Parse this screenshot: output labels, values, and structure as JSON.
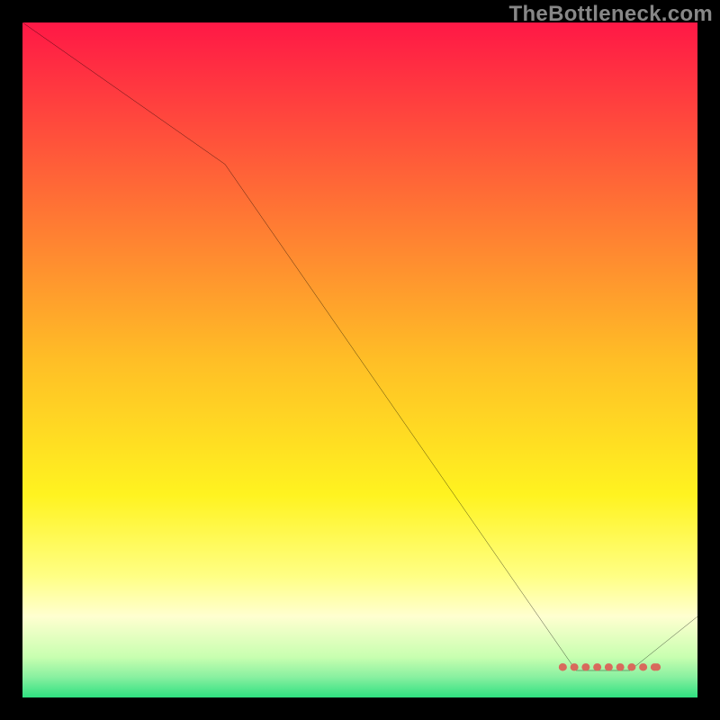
{
  "watermark": "TheBottleneck.com",
  "chart_data": {
    "type": "line",
    "title": "",
    "xlabel": "",
    "ylabel": "",
    "xlim": [
      0,
      100
    ],
    "ylim": [
      0,
      100
    ],
    "grid": false,
    "line": {
      "x": [
        0,
        30,
        82,
        90,
        100
      ],
      "values": [
        100,
        79,
        4,
        4,
        12
      ]
    },
    "gradient_stops": [
      {
        "offset": 0.0,
        "color": "#ff1846"
      },
      {
        "offset": 0.5,
        "color": "#ffbe26"
      },
      {
        "offset": 0.7,
        "color": "#fff320"
      },
      {
        "offset": 0.82,
        "color": "#ffff84"
      },
      {
        "offset": 0.88,
        "color": "#ffffd0"
      },
      {
        "offset": 0.94,
        "color": "#c8ffb0"
      },
      {
        "offset": 0.97,
        "color": "#88f0a0"
      },
      {
        "offset": 1.0,
        "color": "#2fe080"
      }
    ],
    "highlight_band": {
      "x_start": 80,
      "x_end": 94,
      "y": 4.5,
      "color": "#d86a5c"
    }
  }
}
